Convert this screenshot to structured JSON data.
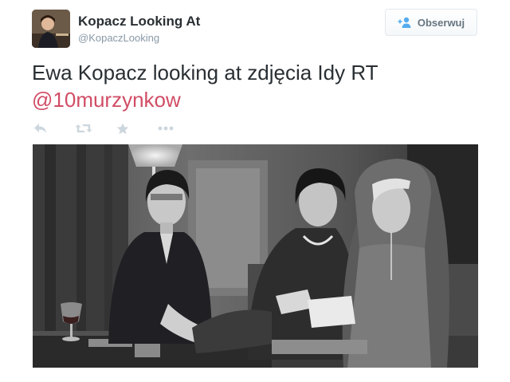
{
  "account": {
    "name": "Kopacz Looking At",
    "handle": "@KopaczLooking",
    "avatar_icon": "profile-photo"
  },
  "follow_button": {
    "label": "Obserwuj",
    "icon": "add-person-icon",
    "icon_color": "#55acee"
  },
  "tweet": {
    "text": "Ewa Kopacz looking at zdjęcia Idy RT",
    "mention": "@10murzynkow",
    "mention_color": "#d14d66"
  },
  "actions": [
    {
      "name": "reply",
      "icon": "reply-icon"
    },
    {
      "name": "retweet",
      "icon": "retweet-icon"
    },
    {
      "name": "favorite",
      "icon": "star-icon"
    },
    {
      "name": "more",
      "icon": "more-dots-icon"
    }
  ],
  "media": {
    "type": "black-and-white photo",
    "icon": "tweet-image"
  }
}
